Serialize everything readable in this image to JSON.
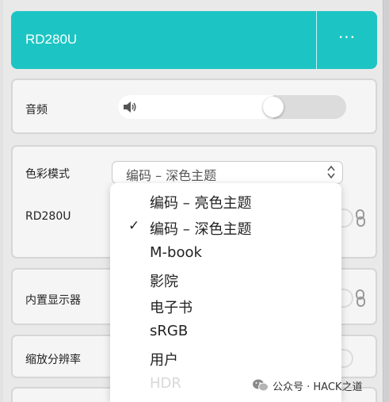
{
  "header": {
    "title": "RD280U",
    "more_label": "···"
  },
  "audio": {
    "label": "音频",
    "volume_percent": 70
  },
  "color_mode": {
    "label": "色彩模式",
    "selected": "编码 – 深色主题",
    "sub_label": "RD280U",
    "options": [
      {
        "label": "编码 – 亮色主题",
        "checked": false
      },
      {
        "label": "编码 – 深色主题",
        "checked": true
      },
      {
        "label": "M-book",
        "checked": false
      },
      {
        "label": "影院",
        "checked": false
      },
      {
        "label": "电子书",
        "checked": false
      },
      {
        "label": "sRGB",
        "checked": false
      },
      {
        "label": "用户",
        "checked": false
      },
      {
        "label": "HDR",
        "checked": false
      }
    ]
  },
  "builtin_display": {
    "label": "内置显示器"
  },
  "scaling": {
    "label": "缩放分辨率"
  },
  "watermark": {
    "text": "公众号 · HACK之道"
  },
  "colors": {
    "accent": "#1cc5c3",
    "background": "#e9e9e9",
    "card": "#f5f5f5"
  }
}
